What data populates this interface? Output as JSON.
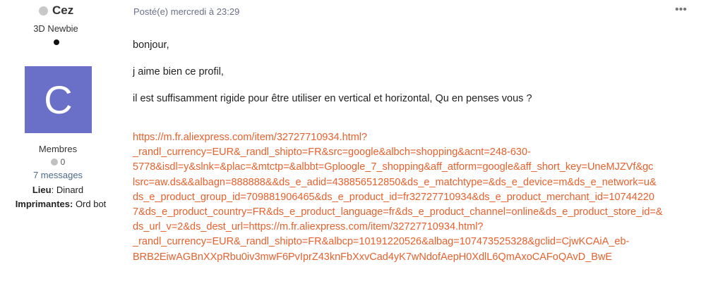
{
  "author": {
    "name": "Cez",
    "title": "3D Newbie",
    "avatar_letter": "C",
    "avatar_color": "#6a6fc7",
    "group": "Membres",
    "reputation": "0",
    "messages": "7 messages",
    "location_label": "Lieu",
    "location_value": ": Dinard",
    "printers_label": "Imprimantes:",
    "printers_value": " Ord bot"
  },
  "post": {
    "meta": "Posté(e) mercredi à 23:29",
    "more_icon": "•••",
    "paragraphs": [
      "bonjour,",
      "j aime bien ce profil,",
      "il est suffisamment  rigide pour être utiliser en vertical et horizontal, Qu en penses vous ?"
    ],
    "link_color": "#e8602c",
    "link_lines": [
      "https://m.fr.aliexpress.com/item/32727710934.html?",
      "_randl_currency=EUR&_randl_shipto=FR&src=google&albch=shopping&acnt=248-630-",
      "5778&isdl=y&slnk=&plac=&mtctp=&albbt=Gploogle_7_shopping&aff_atform=google&aff_short_key=UneMJZVf&gc",
      "lsrc=aw.ds&&albagn=888888&&ds_e_adid=438856512850&ds_e_matchtype=&ds_e_device=m&ds_e_network=u&",
      "ds_e_product_group_id=709881906465&ds_e_product_id=fr32727710934&ds_e_product_merchant_id=10744220",
      "7&ds_e_product_country=FR&ds_e_product_language=fr&ds_e_product_channel=online&ds_e_product_store_id=&",
      "ds_url_v=2&ds_dest_url=https://m.fr.aliexpress.com/item/32727710934.html?",
      "_randl_currency=EUR&_randl_shipto=FR&albcp=10191220526&albag=107473525328&gclid=CjwKCAiA_eb-",
      "BRB2EiwAGBnXXpRbu0iv3mwF6PvIprZ43knFbXxvCad4yK7wNdofAepH0XdlL6QmAxoCAFoQAvD_BwE"
    ]
  }
}
